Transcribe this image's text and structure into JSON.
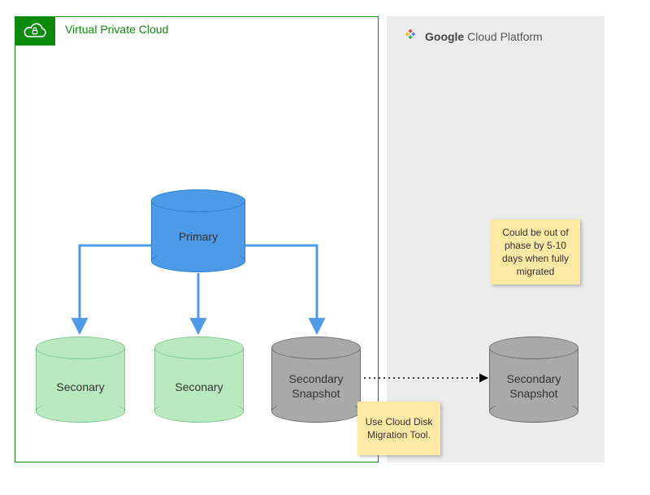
{
  "vpc": {
    "title": "Virtual Private Cloud",
    "icon_name": "cloud-lock-icon"
  },
  "gcp": {
    "label_bold": "Google",
    "label_rest": " Cloud Platform"
  },
  "nodes": {
    "primary": {
      "label": "Primary"
    },
    "seconary1": {
      "label": "Seconary"
    },
    "seconary2": {
      "label": "Seconary"
    },
    "snapshot1": {
      "label": "Secondary\nSnapshot"
    },
    "snapshot2": {
      "label": "Secondary\nSnapshot"
    }
  },
  "notes": {
    "phase": "Could be out of phase by 5-10 days when fully migrated",
    "tool": "Use Cloud Disk Migration Tool."
  },
  "colors": {
    "vpc_green": "#0b8a0b",
    "primary_blue": "#4d9be8",
    "arrow_blue": "#4d9be8",
    "seconary_green": "#b9e9bf",
    "snapshot_grey": "#a9a9a9",
    "note_yellow": "#fde9a4",
    "gcp_panel": "#ececec"
  },
  "edges": [
    {
      "from": "primary",
      "to": "seconary1",
      "style": "solid-blue-arrow"
    },
    {
      "from": "primary",
      "to": "seconary2",
      "style": "solid-blue-arrow"
    },
    {
      "from": "primary",
      "to": "snapshot1",
      "style": "solid-blue-arrow"
    },
    {
      "from": "snapshot1",
      "to": "snapshot2",
      "style": "dotted-black-arrow"
    }
  ]
}
